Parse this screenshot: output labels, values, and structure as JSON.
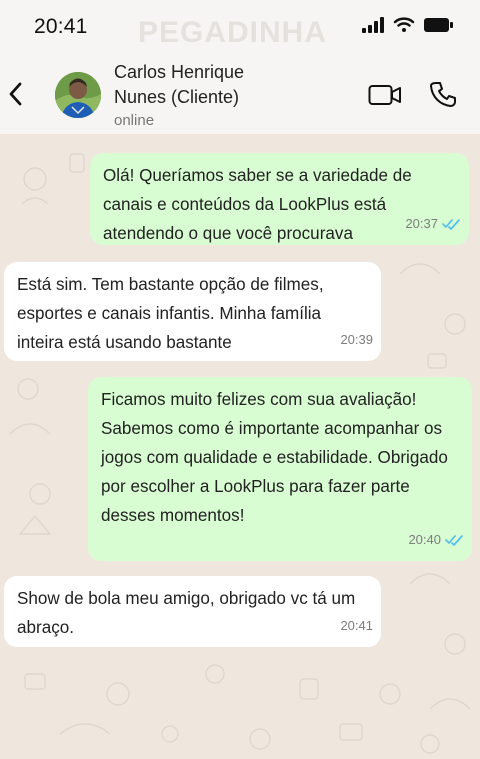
{
  "status_bar": {
    "time": "20:41",
    "watermark": "PEGADINHA"
  },
  "contact": {
    "name": "Carlos Henrique Nunes (Cliente)",
    "status": "online"
  },
  "messages": [
    {
      "direction": "outgoing",
      "text": "Olá! Queríamos saber se a variedade de canais e conteúdos da LookPlus está atendendo o que você procurava",
      "time": "20:37",
      "read": true
    },
    {
      "direction": "incoming",
      "text": "Está sim. Tem bastante opção de filmes, esportes e canais infantis. Minha família inteira está usando bastante",
      "time": "20:39"
    },
    {
      "direction": "outgoing",
      "text": "Ficamos muito felizes com sua avaliação! Sabemos como é importante acompanhar os jogos com qualidade e estabilidade. Obrigado por escolher a LookPlus para fazer parte desses momentos!",
      "time": "20:40",
      "read": true
    },
    {
      "direction": "incoming",
      "text": "Show de bola meu amigo, obrigado vc tá um abraço.",
      "time": "20:41"
    }
  ],
  "colors": {
    "outgoing_bubble": "#d9fdd3",
    "incoming_bubble": "#ffffff",
    "read_ticks": "#53bdeb"
  }
}
